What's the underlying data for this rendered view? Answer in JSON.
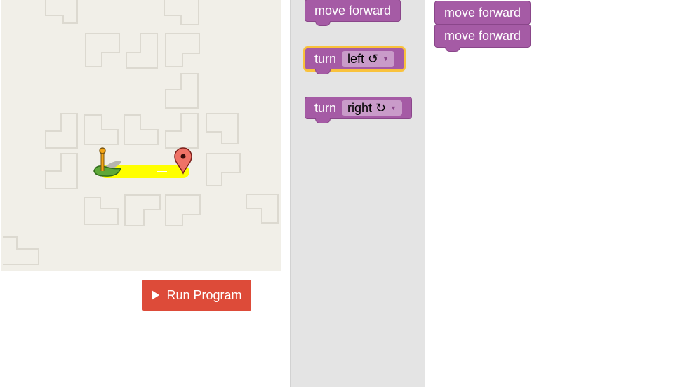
{
  "toolbox": {
    "move_forward_label": "move forward",
    "turn_left_prefix": "turn",
    "turn_left_value": "left ↺",
    "turn_right_prefix": "turn",
    "turn_right_value": "right ↻"
  },
  "workspace": {
    "blocks": [
      {
        "label": "move forward"
      },
      {
        "label": "move forward"
      }
    ]
  },
  "controls": {
    "run_label": "Run Program"
  },
  "colors": {
    "block": "#a55ba5",
    "run_button": "#dd4b39",
    "path": "#ffff00",
    "selected_outline": "#f9c23c"
  }
}
